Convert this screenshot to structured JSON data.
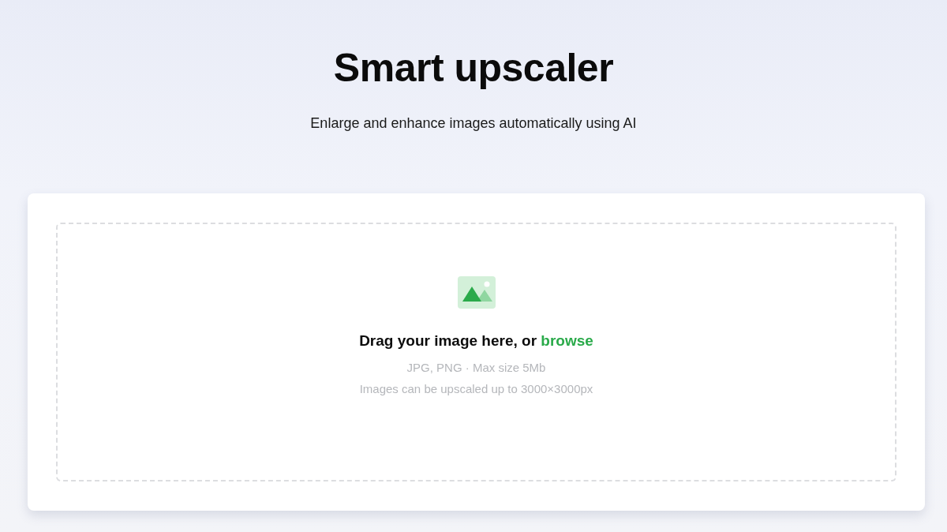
{
  "header": {
    "title": "Smart upscaler",
    "subtitle": "Enlarge and enhance images automatically using AI"
  },
  "dropzone": {
    "prompt": "Drag your image here, or",
    "link": "browse",
    "formats": "JPG, PNG · Max size 5Mb",
    "limit": "Images can be upscaled up to 3000×3000px"
  }
}
